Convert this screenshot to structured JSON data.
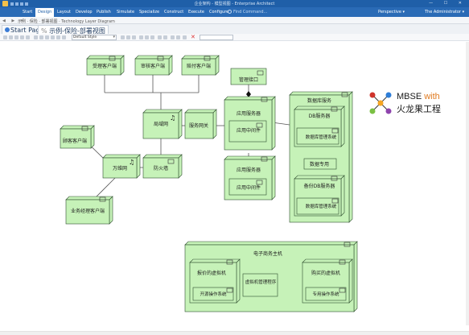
{
  "window": {
    "title": "企业架构 - 模型视图 - Enterprise Architect",
    "controls": "— ☐ ✕"
  },
  "menu": {
    "items": [
      "Start",
      "Design",
      "Layout",
      "Develop",
      "Publish",
      "Simulate",
      "Specialize",
      "Construct",
      "Execute",
      "Configure"
    ],
    "active_index": 1,
    "find_placeholder": "Find Command...",
    "perspective_label": "Perspective ▾",
    "user_label": "The Administrator ▾"
  },
  "breadcrumb": {
    "nav": "◀ ▶ ▾",
    "path": "示例 · 保险 · 部署视图 · Technology Layer Diagram"
  },
  "tabs": {
    "start_label": "Start Page",
    "diagram_label": "示例-保险-部署视图",
    "separator": " % "
  },
  "toolbar": {
    "style_value": "Default Style"
  },
  "watermark": {
    "line1_main": "MBSE ",
    "line1_accent": "with",
    "line2": "火龙果工程",
    "accent_color": "#e07a1f",
    "logo_colors": [
      "#d0342c",
      "#2e7dd7",
      "#f5a623",
      "#7ac043",
      "#8e44ad"
    ]
  },
  "diagram": {
    "node_fill": "#c6f2b8",
    "node_stroke": "#2f4f2f",
    "nodes": {
      "client_accept": "受理客户端",
      "client_review": "审核客户端",
      "client_pay": "赔付客户端",
      "mgmt_interface": "管理接口",
      "app_server_1": "应用服务器",
      "middleware_1": "应用中间件",
      "service_gateway": "服务网关",
      "lan": "局域网",
      "db_service": "数据库服务",
      "db_server": "DB服务器",
      "dbms_1": "数据库管理系统",
      "db_dedicated": "数据专用",
      "backup_db_server": "备份DB服务器",
      "dbms_2": "数据库管理系统",
      "customer_client": "顾客客户端",
      "wan": "万维网",
      "firewall": "防火墙",
      "app_server_2": "应用服务器",
      "middleware_2": "应用中间件",
      "agent_manager_client": "业务经理客户端",
      "ecommerce_host": "电子商务主机",
      "vm_quote": "报价的虚拟机",
      "os_open": "开源操作系统",
      "vm_manager": "虚拟机管理程序",
      "vm_purchase": "购买的虚拟机",
      "os_dedicated": "专用操作系统"
    }
  }
}
